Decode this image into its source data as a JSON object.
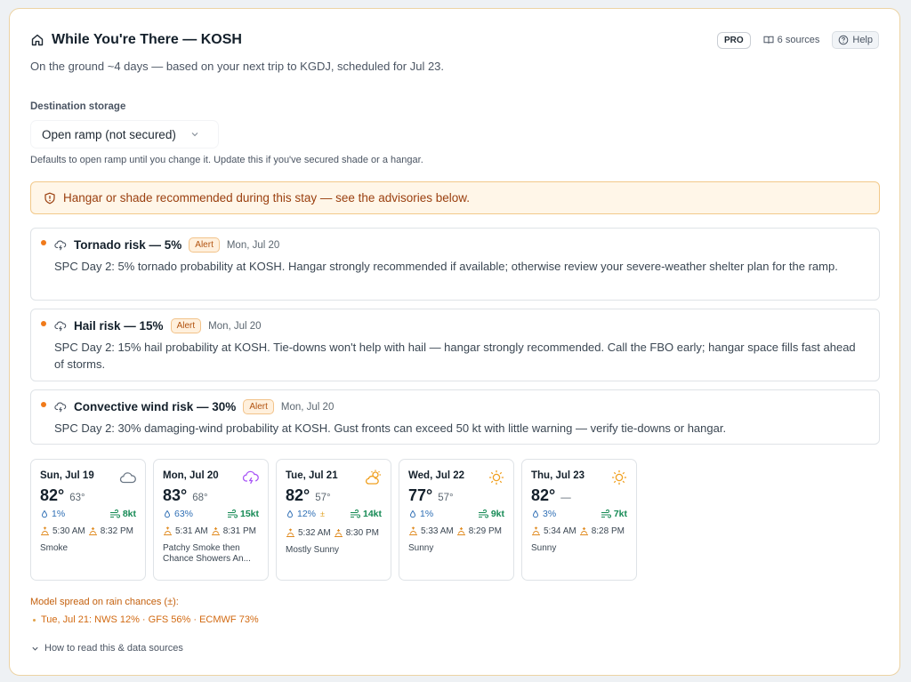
{
  "header": {
    "title": "While You're There — KOSH",
    "subtitle": "On the ground ~4 days — based on your next trip to KGDJ, scheduled for Jul 23.",
    "pro_badge": "PRO",
    "sources_label": "6 sources",
    "help_label": "Help",
    "icons": {
      "title": "home-icon",
      "sources": "book-icon",
      "help": "help-circle-icon"
    }
  },
  "storage": {
    "label": "Destination storage",
    "selected": "Open ramp (not secured)",
    "hint": "Defaults to open ramp until you change it. Update this if you've secured shade or a hangar."
  },
  "banner": {
    "text": "Hangar or shade recommended during this stay — see the advisories below.",
    "icon": "shield-alert-icon"
  },
  "alerts": [
    {
      "title": "Tornado risk — 5%",
      "badge": "Alert",
      "date": "Mon, Jul 20",
      "body": "SPC Day 2: 5% tornado probability at KOSH. Hangar strongly recommended if available; otherwise review your severe-weather shelter plan for the ramp."
    },
    {
      "title": "Hail risk — 15%",
      "badge": "Alert",
      "date": "Mon, Jul 20",
      "body": "SPC Day 2: 15% hail probability at KOSH. Tie-downs won't help with hail — hangar strongly recommended. Call the FBO early; hangar space fills fast ahead of storms."
    },
    {
      "title": "Convective wind risk — 30%",
      "badge": "Alert",
      "date": "Mon, Jul 20",
      "body": "SPC Day 2: 30% damaging-wind probability at KOSH. Gust fronts can exceed 50 kt with little warning — verify tie-downs or hangar."
    }
  ],
  "forecast": [
    {
      "day": "Sun, Jul 19",
      "icon": "cloud-icon",
      "hi": "82°",
      "lo": "63°",
      "rain": "1%",
      "wind": "8kt",
      "sunrise": "5:30 AM",
      "sunset": "8:32 PM",
      "condition": "Smoke"
    },
    {
      "day": "Mon, Jul 20",
      "icon": "storm-cloud-icon",
      "hi": "83°",
      "lo": "68°",
      "rain": "63%",
      "wind": "15kt",
      "sunrise": "5:31 AM",
      "sunset": "8:31 PM",
      "condition": "Patchy Smoke then Chance Showers An..."
    },
    {
      "day": "Tue, Jul 21",
      "icon": "partly-sunny-icon",
      "hi": "82°",
      "lo": "57°",
      "rain": "12%",
      "rain_flag": "±",
      "wind": "14kt",
      "sunrise": "5:32 AM",
      "sunset": "8:30 PM",
      "condition": "Mostly Sunny"
    },
    {
      "day": "Wed, Jul 22",
      "icon": "sun-icon",
      "hi": "77°",
      "lo": "57°",
      "rain": "1%",
      "wind": "9kt",
      "sunrise": "5:33 AM",
      "sunset": "8:29 PM",
      "condition": "Sunny"
    },
    {
      "day": "Thu, Jul 23",
      "icon": "sun-icon",
      "hi": "82°",
      "lo": "—",
      "rain": "3%",
      "wind": "7kt",
      "sunrise": "5:34 AM",
      "sunset": "8:28 PM",
      "condition": "Sunny"
    }
  ],
  "model_spread": {
    "label": "Model spread on rain chances (±):",
    "items": [
      "Tue, Jul 21: NWS 12% · GFS 56% · ECMWF 73%"
    ]
  },
  "footer": {
    "howto": "How to read this & data sources"
  },
  "colors": {
    "banner_bg": "#fff6e8",
    "banner_text": "#9a3f0f",
    "alert_dot": "#f07a1a",
    "rain": "#2f6fb5",
    "wind": "#168a55",
    "sun": "#f0a020",
    "storm": "#a855f7",
    "cloud": "#6b7785"
  }
}
